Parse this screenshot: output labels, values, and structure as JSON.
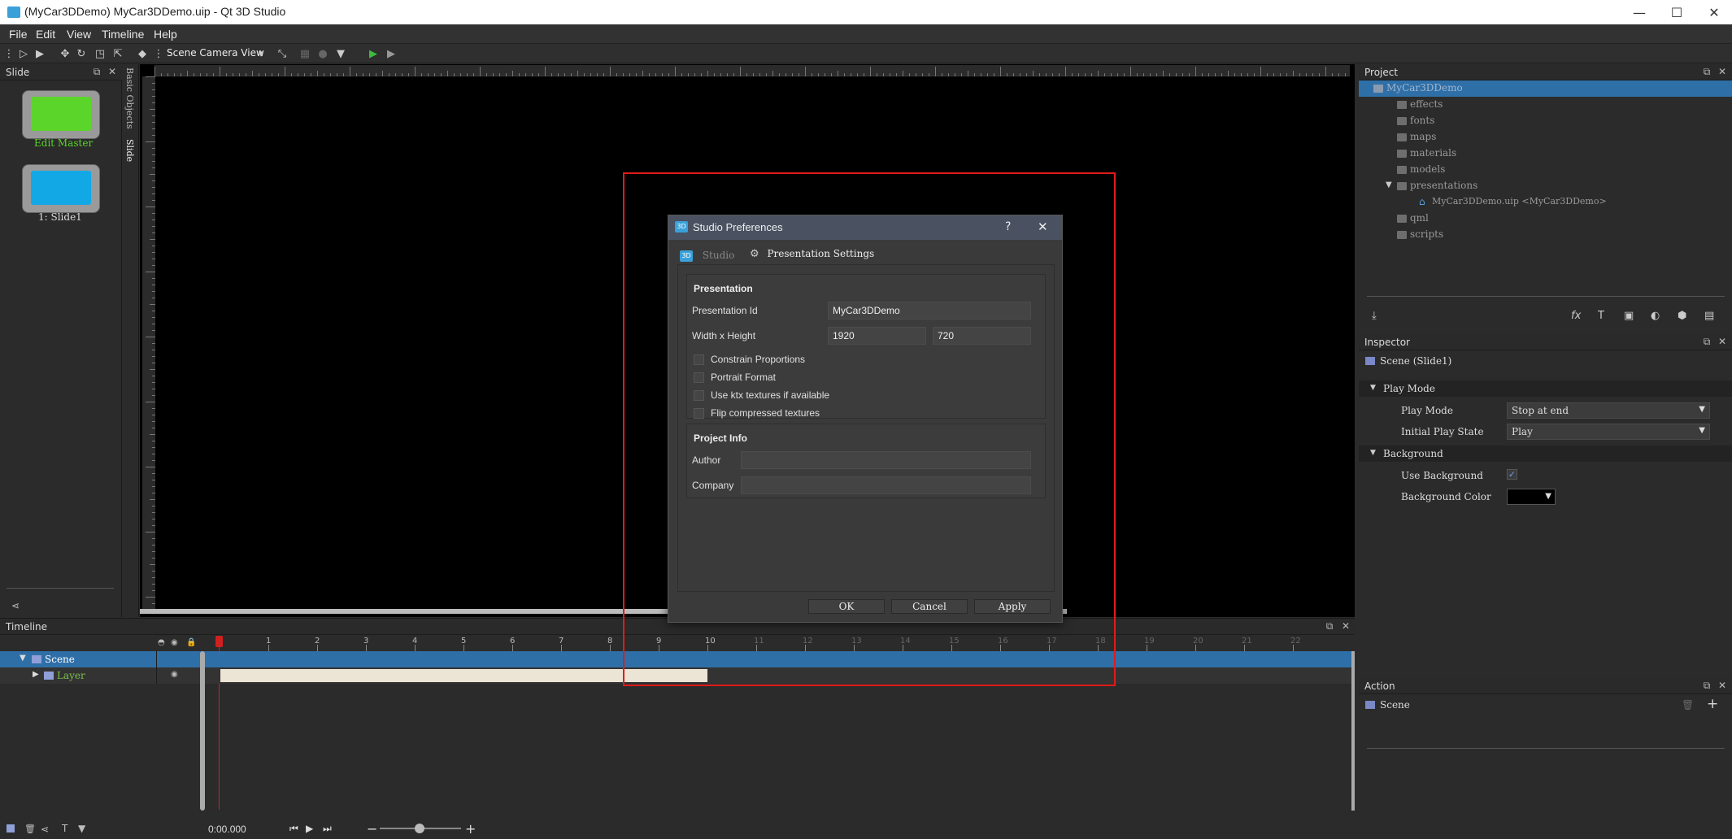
{
  "window": {
    "title": "(MyCar3DDemo) MyCar3DDemo.uip - Qt 3D Studio",
    "minimize_glyph": "—",
    "maximize_glyph": "☐",
    "close_glyph": "✕"
  },
  "menubar": [
    "File",
    "Edit",
    "View",
    "Timeline",
    "Help"
  ],
  "toolbar": {
    "camera_view": "Scene Camera View"
  },
  "slide_panel": {
    "title": "Slide",
    "master_label": "Edit Master",
    "slide_label": "1: Slide1",
    "vertical_tabs": [
      "Basic Objects",
      "Slide"
    ]
  },
  "project_panel": {
    "title": "Project",
    "tree": [
      {
        "label": "MyCar3DDemo",
        "level": 0,
        "selected": true
      },
      {
        "label": "effects",
        "level": 1
      },
      {
        "label": "fonts",
        "level": 1
      },
      {
        "label": "maps",
        "level": 1
      },
      {
        "label": "materials",
        "level": 1
      },
      {
        "label": "models",
        "level": 1
      },
      {
        "label": "presentations",
        "level": 1,
        "expanded": true
      },
      {
        "label": "MyCar3DDemo.uip <MyCar3DDemo>",
        "level": 2
      },
      {
        "label": "qml",
        "level": 1
      },
      {
        "label": "scripts",
        "level": 1
      }
    ]
  },
  "inspector": {
    "title": "Inspector",
    "object": "Scene (Slide1)",
    "sections": {
      "play_mode": "Play Mode",
      "background": "Background"
    },
    "props": {
      "play_mode_label": "Play Mode",
      "play_mode_value": "Stop at end",
      "initial_play_state_label": "Initial Play State",
      "initial_play_state_value": "Play",
      "use_background_label": "Use Background",
      "use_background_checked": true,
      "background_color_label": "Background Color",
      "background_color_value": "#000000"
    }
  },
  "action_panel": {
    "title": "Action",
    "item": "Scene"
  },
  "timeline": {
    "title": "Timeline",
    "rows": [
      {
        "label": "Scene",
        "selected": true
      },
      {
        "label": "Layer"
      }
    ],
    "ticks": [
      "1",
      "2",
      "3",
      "4",
      "5",
      "6",
      "7",
      "8",
      "9",
      "10",
      "11",
      "12",
      "13",
      "14",
      "15",
      "16",
      "17",
      "18",
      "19",
      "20",
      "21",
      "22"
    ],
    "time": "0:00.000"
  },
  "dialog": {
    "title": "Studio Preferences",
    "help_glyph": "?",
    "close_glyph": "✕",
    "tabs": [
      "Studio",
      "Presentation Settings"
    ],
    "presentation_group": "Presentation",
    "presentation_id_label": "Presentation Id",
    "presentation_id_value": "MyCar3DDemo",
    "size_label": "Width x Height",
    "width": "1920",
    "height": "720",
    "checkboxes": [
      "Constrain Proportions",
      "Portrait Format",
      "Use ktx textures if available",
      "Flip compressed textures"
    ],
    "project_info_group": "Project Info",
    "author_label": "Author",
    "author_value": "",
    "company_label": "Company",
    "company_value": "",
    "ok": "OK",
    "cancel": "Cancel",
    "apply": "Apply"
  },
  "colors": {
    "accent_blue": "#2f6fa7",
    "master_green": "#5cd52a",
    "slide_blue": "#12a8e6",
    "highlight_red": "#e01b1b",
    "play_green": "#3dbb3d"
  }
}
